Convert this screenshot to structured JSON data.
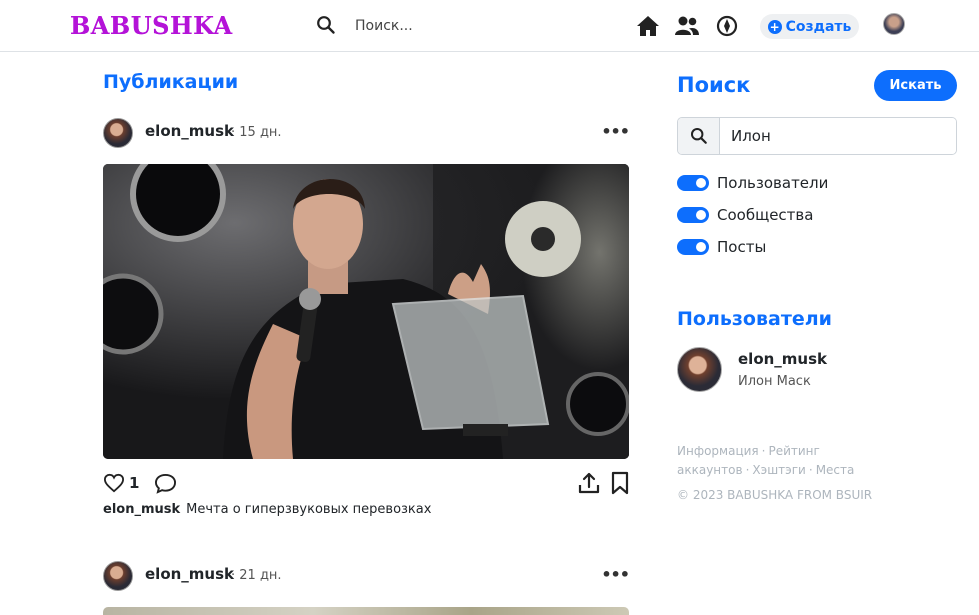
{
  "header": {
    "logo": "BABUSHKA",
    "search_placeholder": "Поиск...",
    "create_label": "Создать"
  },
  "feed": {
    "title": "Публикации",
    "posts": [
      {
        "user": "elon_musk",
        "time": "· 15 дн.",
        "likes": "1",
        "caption_user": "elon_musk",
        "caption_text": "Мечта о гиперзвуковых перевозках"
      },
      {
        "user": "elon_musk",
        "time": "· 21 дн."
      }
    ]
  },
  "sidebar": {
    "search_title": "Поиск",
    "search_button": "Искать",
    "search_value": "Илон",
    "filters": [
      {
        "label": "Пользователи",
        "checked": true
      },
      {
        "label": "Сообщества",
        "checked": true
      },
      {
        "label": "Посты",
        "checked": true
      }
    ],
    "users_title": "Пользователи",
    "users": [
      {
        "username": "elon_musk",
        "full_name": "Илон Маск"
      }
    ],
    "footer_links": [
      "Информация",
      "Рейтинг аккаунтов",
      "Хэштэги",
      "Места"
    ],
    "copyright": "© 2023 BABUSHKA FROM BSUIR"
  },
  "colors": {
    "accent": "#0d6efd",
    "logo": "#b413d8"
  }
}
